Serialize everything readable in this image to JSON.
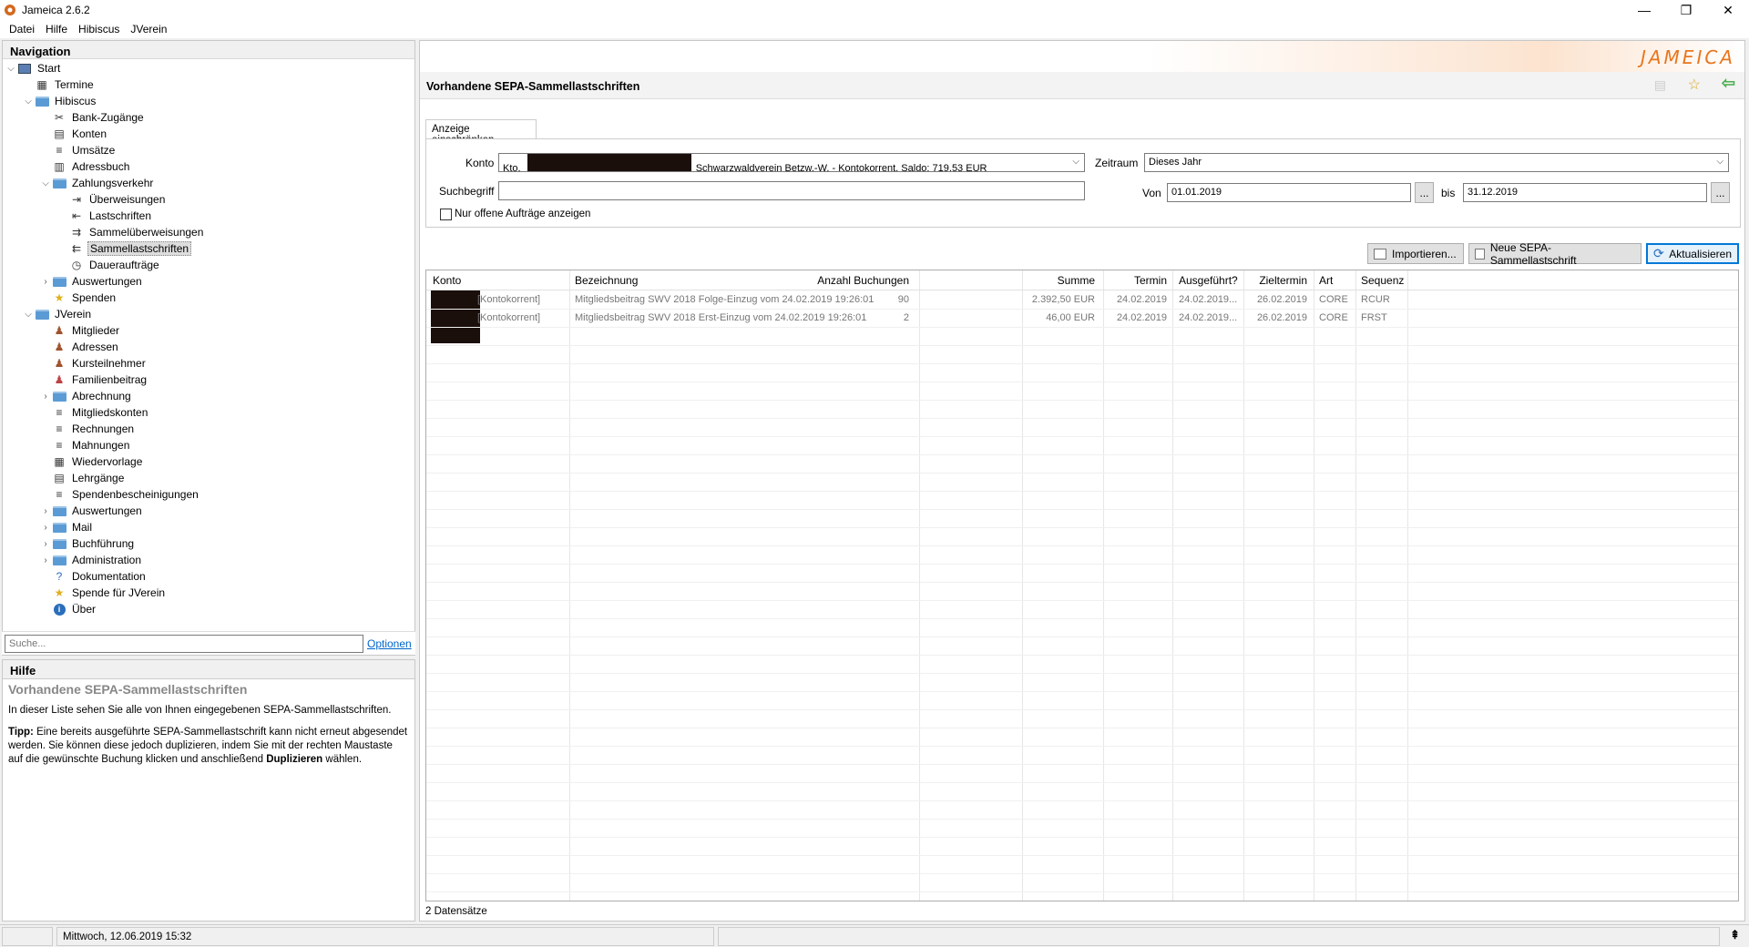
{
  "window": {
    "title": "Jameica 2.6.2",
    "controls": [
      "—",
      "❐",
      "✕"
    ]
  },
  "menu": [
    "Datei",
    "Hilfe",
    "Hibiscus",
    "JVerein"
  ],
  "navigation": {
    "title": "Navigation",
    "items": [
      {
        "label": "Start",
        "depth": 0,
        "toggle": "⌵",
        "icon": "computer-icon",
        "selected": false
      },
      {
        "label": "Termine",
        "depth": 1,
        "toggle": "",
        "icon": "calendar-icon"
      },
      {
        "label": "Hibiscus",
        "depth": 1,
        "toggle": "⌵",
        "icon": "folder-icon"
      },
      {
        "label": "Bank-Zugänge",
        "depth": 2,
        "toggle": "",
        "icon": "tools-icon"
      },
      {
        "label": "Konten",
        "depth": 2,
        "toggle": "",
        "icon": "account-icon"
      },
      {
        "label": "Umsätze",
        "depth": 2,
        "toggle": "",
        "icon": "list-icon"
      },
      {
        "label": "Adressbuch",
        "depth": 2,
        "toggle": "",
        "icon": "addressbook-icon"
      },
      {
        "label": "Zahlungsverkehr",
        "depth": 2,
        "toggle": "⌵",
        "icon": "folder-icon"
      },
      {
        "label": "Überweisungen",
        "depth": 3,
        "toggle": "",
        "icon": "transfer-icon"
      },
      {
        "label": "Lastschriften",
        "depth": 3,
        "toggle": "",
        "icon": "debit-icon"
      },
      {
        "label": "Sammelüberweisungen",
        "depth": 3,
        "toggle": "",
        "icon": "collective-transfer-icon"
      },
      {
        "label": "Sammellastschriften",
        "depth": 3,
        "toggle": "",
        "icon": "collective-debit-icon",
        "selected": true
      },
      {
        "label": "Daueraufträge",
        "depth": 3,
        "toggle": "",
        "icon": "clock-icon"
      },
      {
        "label": "Auswertungen",
        "depth": 2,
        "toggle": "›",
        "icon": "folder-icon"
      },
      {
        "label": "Spenden",
        "depth": 2,
        "toggle": "",
        "icon": "star-icon"
      },
      {
        "label": "JVerein",
        "depth": 1,
        "toggle": "⌵",
        "icon": "folder-icon"
      },
      {
        "label": "Mitglieder",
        "depth": 2,
        "toggle": "",
        "icon": "members-icon"
      },
      {
        "label": "Adressen",
        "depth": 2,
        "toggle": "",
        "icon": "person-icon"
      },
      {
        "label": "Kursteilnehmer",
        "depth": 2,
        "toggle": "",
        "icon": "person-icon"
      },
      {
        "label": "Familienbeitrag",
        "depth": 2,
        "toggle": "",
        "icon": "family-icon"
      },
      {
        "label": "Abrechnung",
        "depth": 2,
        "toggle": "›",
        "icon": "folder-icon"
      },
      {
        "label": "Mitgliedskonten",
        "depth": 2,
        "toggle": "",
        "icon": "list-icon"
      },
      {
        "label": "Rechnungen",
        "depth": 2,
        "toggle": "",
        "icon": "list-icon"
      },
      {
        "label": "Mahnungen",
        "depth": 2,
        "toggle": "",
        "icon": "list-icon"
      },
      {
        "label": "Wiedervorlage",
        "depth": 2,
        "toggle": "",
        "icon": "calendar-icon"
      },
      {
        "label": "Lehrgänge",
        "depth": 2,
        "toggle": "",
        "icon": "course-icon"
      },
      {
        "label": "Spendenbescheinigungen",
        "depth": 2,
        "toggle": "",
        "icon": "list-icon"
      },
      {
        "label": "Auswertungen",
        "depth": 2,
        "toggle": "›",
        "icon": "folder-icon"
      },
      {
        "label": "Mail",
        "depth": 2,
        "toggle": "›",
        "icon": "folder-icon"
      },
      {
        "label": "Buchführung",
        "depth": 2,
        "toggle": "›",
        "icon": "folder-icon"
      },
      {
        "label": "Administration",
        "depth": 2,
        "toggle": "›",
        "icon": "folder-icon"
      },
      {
        "label": "Dokumentation",
        "depth": 2,
        "toggle": "",
        "icon": "help-icon"
      },
      {
        "label": "Spende für JVerein",
        "depth": 2,
        "toggle": "",
        "icon": "star-icon"
      },
      {
        "label": "Über",
        "depth": 2,
        "toggle": "",
        "icon": "info-icon"
      }
    ],
    "search_placeholder": "Suche...",
    "options_link": "Optionen"
  },
  "help": {
    "title": "Hilfe",
    "heading": "Vorhandene SEPA-Sammellastschriften",
    "text1": "In dieser Liste sehen Sie alle von Ihnen eingegebenen SEPA-Sammellastschriften.",
    "tip_label": "Tipp:",
    "tip_text": " Eine bereits ausgeführte SEPA-Sammellastschrift kann nicht erneut abgesendet werden. Sie können diese jedoch duplizieren, indem Sie mit der rechten Maustaste auf die gewünschte Buchung klicken und anschließend ",
    "tip_bold": "Duplizieren",
    "tip_end": " wählen."
  },
  "main": {
    "logo": "JAMEICA",
    "title": "Vorhandene SEPA-Sammellastschriften",
    "filter_tab": "Anzeige einschränken",
    "konto_label": "Konto",
    "konto_value_prefix": "Kto.",
    "konto_value": "Schwarzwaldverein Betzw.-W. - Kontokorrent, Saldo: 719,53 EUR",
    "zeitraum_label": "Zeitraum",
    "zeitraum_value": "Dieses Jahr",
    "suchbegriff_label": "Suchbegriff",
    "suchbegriff_value": "",
    "von_label": "Von",
    "von_value": "01.01.2019",
    "bis_label": "bis",
    "bis_value": "31.12.2019",
    "dots": "...",
    "offene_label": "Nur offene Aufträge anzeigen",
    "buttons": {
      "import": "Importieren...",
      "new": "Neue SEPA-Sammellastschrift",
      "refresh": "Aktualisieren"
    },
    "columns": [
      "Konto",
      "Bezeichnung",
      "Anzahl Buchungen",
      "Summe",
      "Termin",
      "Ausgeführt?",
      "Zieltermin",
      "Art",
      "Sequenz"
    ],
    "rows": [
      {
        "konto": "[Kontokorrent]",
        "bezeichnung": "Mitgliedsbeitrag SWV 2018 Folge-Einzug vom 24.02.2019 19:26:01",
        "anzahl": "90",
        "summe": "2.392,50 EUR",
        "termin": "24.02.2019",
        "ausgefuehrt": "24.02.2019...",
        "zieltermin": "26.02.2019",
        "art": "CORE",
        "sequenz": "RCUR"
      },
      {
        "konto": "[Kontokorrent]",
        "bezeichnung": "Mitgliedsbeitrag SWV 2018 Erst-Einzug vom 24.02.2019 19:26:01",
        "anzahl": "2",
        "summe": "46,00 EUR",
        "termin": "24.02.2019",
        "ausgefuehrt": "24.02.2019...",
        "zieltermin": "26.02.2019",
        "art": "CORE",
        "sequenz": "FRST"
      }
    ],
    "record_count": "2 Datensätze"
  },
  "status": {
    "datetime": "Mittwoch, 12.06.2019 15:32"
  },
  "colors": {
    "accent": "#e8761e",
    "selection_border": "#0078d7",
    "folder": "#5b9bd5"
  }
}
